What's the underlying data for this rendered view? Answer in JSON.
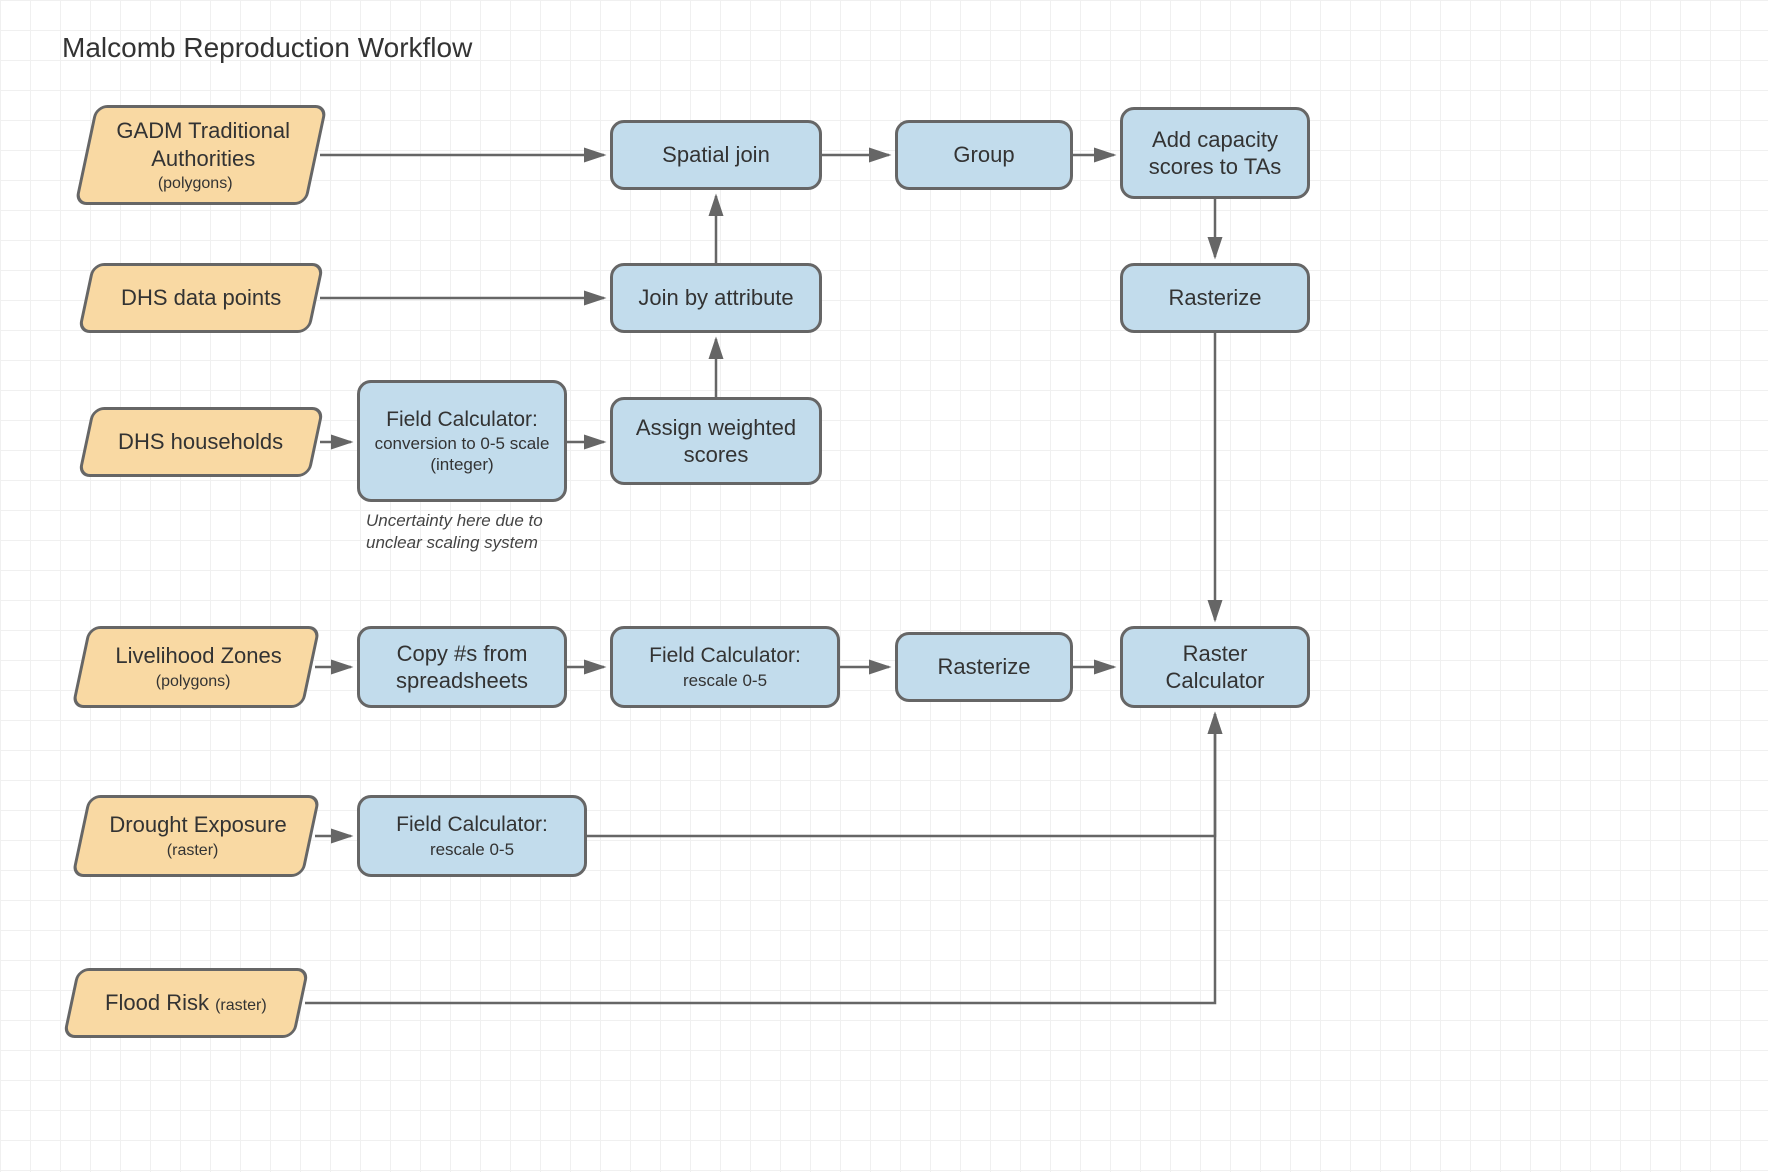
{
  "title": "Malcomb Reproduction Workflow",
  "nodes": {
    "gadm": {
      "main": "GADM Traditional Authorities",
      "sub": "(polygons)"
    },
    "dhs_points": {
      "main": "DHS data points"
    },
    "dhs_hh": {
      "main": "DHS households"
    },
    "livezones": {
      "main": "Livelihood Zones",
      "sub": "(polygons)"
    },
    "drought": {
      "main": "Drought Exposure",
      "sub": "(raster)"
    },
    "flood": {
      "main": "Flood Risk",
      "sub": "(raster)"
    },
    "spatial_join": {
      "main": "Spatial join"
    },
    "group": {
      "main": "Group"
    },
    "add_cap": {
      "main": "Add capacity scores to TAs"
    },
    "rasterize1": {
      "main": "Rasterize"
    },
    "join_attr": {
      "main": "Join by attribute"
    },
    "fc1": {
      "main": "Field Calculator:",
      "sub": "conversion to 0-5 scale (integer)"
    },
    "assign": {
      "main": "Assign weighted scores"
    },
    "copy": {
      "main": "Copy #s from spreadsheets"
    },
    "fc2": {
      "main": "Field Calculator:",
      "sub": "rescale 0-5"
    },
    "rasterize2": {
      "main": "Rasterize"
    },
    "raster_calc": {
      "main": "Raster Calculator"
    },
    "fc3": {
      "main": "Field Calculator:",
      "sub": "rescale 0-5"
    }
  },
  "annotations": {
    "uncertainty": "Uncertainty here due to unclear scaling system"
  }
}
